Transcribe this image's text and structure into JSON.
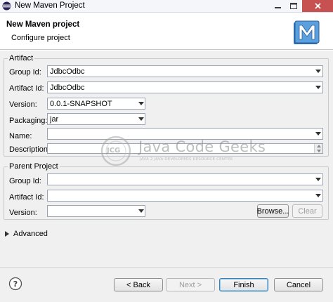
{
  "window": {
    "title": "New Maven Project"
  },
  "header": {
    "title": "New Maven project",
    "subtitle": "Configure project"
  },
  "artifact": {
    "legend": "Artifact",
    "group_id": {
      "label": "Group Id:",
      "value": "JdbcOdbc"
    },
    "artifact_id": {
      "label": "Artifact Id:",
      "value": "JdbcOdbc"
    },
    "version": {
      "label": "Version:",
      "value": "0.0.1-SNAPSHOT"
    },
    "packaging": {
      "label": "Packaging:",
      "value": "jar"
    },
    "name": {
      "label": "Name:",
      "value": ""
    },
    "description": {
      "label": "Description:",
      "value": ""
    }
  },
  "parent": {
    "legend": "Parent Project",
    "group_id": {
      "label": "Group Id:",
      "value": ""
    },
    "artifact_id": {
      "label": "Artifact Id:",
      "value": ""
    },
    "version": {
      "label": "Version:",
      "value": ""
    },
    "browse_label": "Browse...",
    "clear_label": "Clear"
  },
  "advanced": {
    "label": "Advanced"
  },
  "watermark": {
    "initials": "JCG",
    "name": "Java Code Geeks",
    "tagline": "JAVA 2 JAVA DEVELOPERS RESOURCE CENTER"
  },
  "footer": {
    "back_label": "< Back",
    "next_label": "Next >",
    "finish_label": "Finish",
    "cancel_label": "Cancel"
  },
  "colors": {
    "accent": "#3c7fb1",
    "close": "#c75050",
    "maven_logo": "#4b8fd1"
  }
}
